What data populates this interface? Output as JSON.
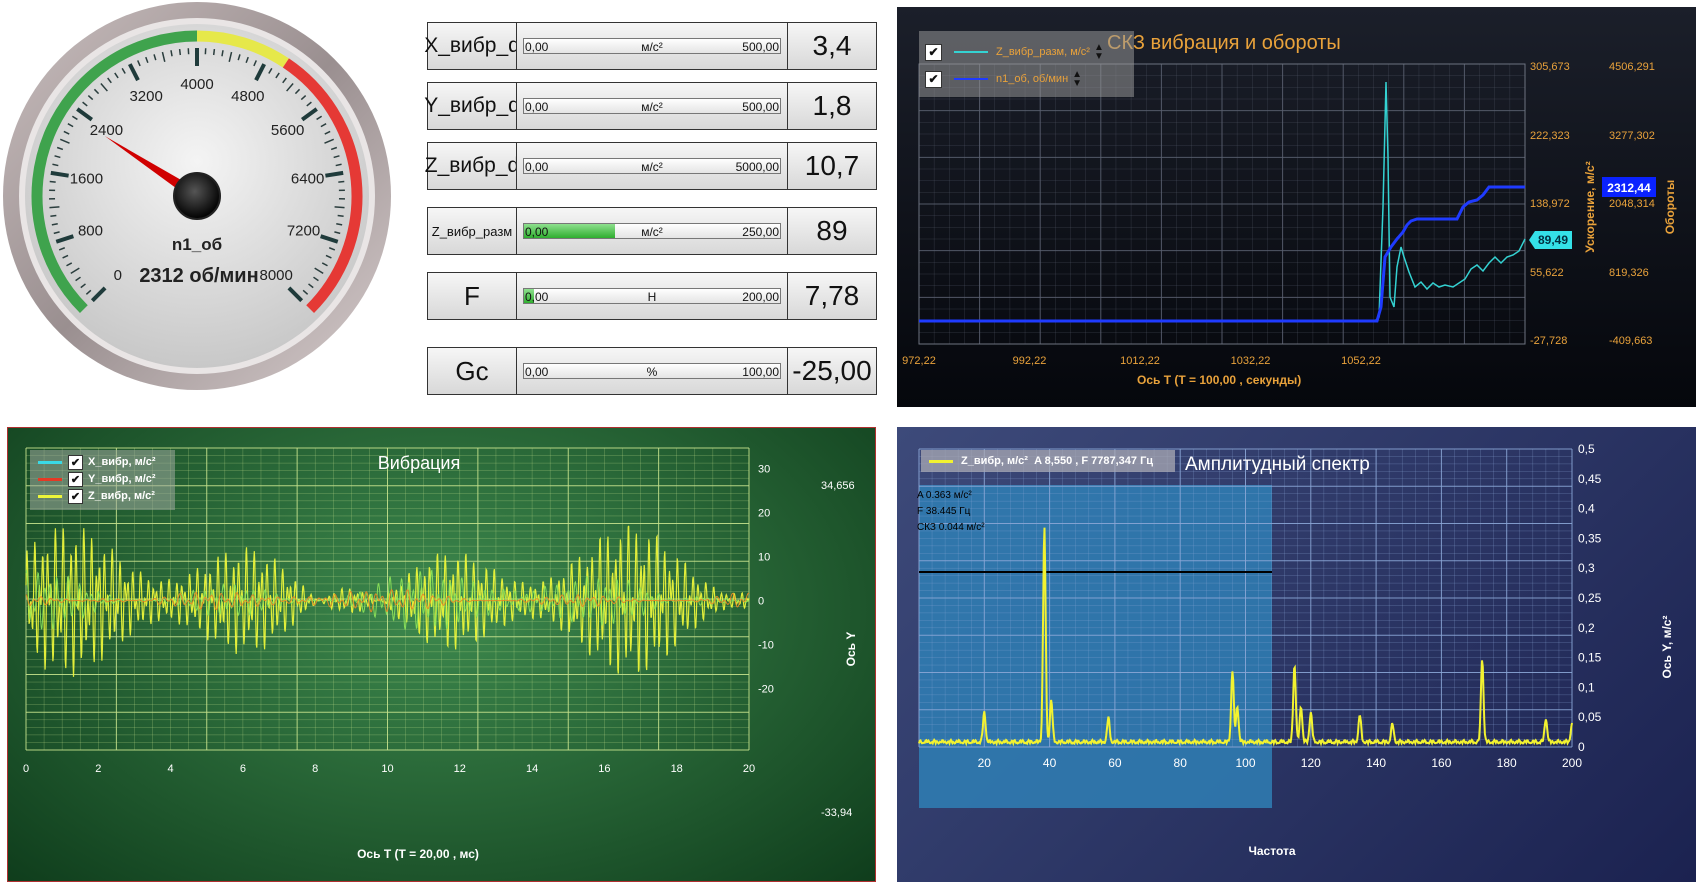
{
  "gauge": {
    "ticks": [
      "0",
      "800",
      "1600",
      "2400",
      "3200",
      "4000",
      "4800",
      "5600",
      "6400",
      "7200",
      "8000"
    ],
    "value": 2312,
    "max": 8000,
    "name": "n1_об",
    "readout": "2312 об/мин",
    "colors": {
      "green": "#3fa34d",
      "yellow": "#e6e84a",
      "red": "#e53935",
      "needle": "#d00000"
    }
  },
  "rows": [
    {
      "label": "X_вибр_d",
      "min": "0,00",
      "unit": "м/с²",
      "max": "500,00",
      "value": "3,4",
      "fill_fraction": 0
    },
    {
      "label": "Y_вибр_d",
      "min": "0,00",
      "unit": "м/с²",
      "max": "500,00",
      "value": "1,8",
      "fill_fraction": 0
    },
    {
      "label": "Z_вибр_d",
      "min": "0,00",
      "unit": "м/с²",
      "max": "5000,00",
      "value": "10,7",
      "fill_fraction": 0
    },
    {
      "label": "Z_вибр_разм",
      "min": "0,00",
      "unit": "м/с²",
      "max": "250,00",
      "value": "89",
      "fill_fraction": 0.356
    },
    {
      "label": "F",
      "min": "0,00",
      "unit": "Н",
      "max": "200,00",
      "value": "7,78",
      "fill_fraction": 0.039
    },
    {
      "label": "Gc",
      "min": "0,00",
      "unit": "%",
      "max": "100,00",
      "value": "-25,00",
      "fill_fraction": 0
    }
  ],
  "chart_skz": {
    "title": "СКЗ вибрация и обороты",
    "legend": [
      {
        "label": "Z_вибр_разм, м/с²",
        "color": "#34d2d2",
        "checked": true
      },
      {
        "label": "n1_об, об/мин",
        "color": "#1f3bff",
        "checked": true
      }
    ],
    "x_ticks": [
      "972,22",
      "992,22",
      "1012,22",
      "1032,22",
      "1052,22"
    ],
    "y1_ticks": [
      "305,673",
      "222,323",
      "138,972",
      "55,622",
      "-27,728"
    ],
    "y2_ticks": [
      "4506,291",
      "3277,302",
      "2048,314",
      "819,326",
      "-409,663"
    ],
    "y1_label": "Ускорение, м/с²",
    "y2_label": "Обороты",
    "x_label": "Ось Т   (Т = 100,00 , секунды)",
    "marker_n1": "2312,44",
    "marker_z": "89,49"
  },
  "chart_vibr": {
    "title": "Вибрация",
    "legend": [
      {
        "label": "X_вибр, м/с²",
        "color": "#3ad9e6",
        "checked": true
      },
      {
        "label": "Y_вибр, м/с²",
        "color": "#e53925",
        "checked": true
      },
      {
        "label": "Z_вибр, м/с²",
        "color": "#ecf53a",
        "checked": true
      }
    ],
    "x_ticks": [
      "0",
      "2",
      "4",
      "6",
      "8",
      "10",
      "12",
      "14",
      "16",
      "18",
      "20"
    ],
    "y_ticks": [
      "30",
      "20",
      "10",
      "0",
      "-10",
      "-20"
    ],
    "y_top": "34,656",
    "y_bottom": "-33,94",
    "y_label": "Ось Y",
    "x_label": "Ось Т  (Т = 20,00 , мс)"
  },
  "chart_spectrum": {
    "title": "Амплитудный спектр",
    "legend_text": "Z_вибр, м/с²  A 8,550 , F 7787,347 Гц",
    "legend_color": "#f2f230",
    "info": [
      "A 0.363 м/с²",
      "F 38.445 Гц",
      "СКЗ 0.044 м/с²"
    ],
    "x_ticks": [
      "20",
      "40",
      "60",
      "80",
      "100",
      "120",
      "140",
      "160",
      "180",
      "200"
    ],
    "y_ticks": [
      "0,5",
      "0,45",
      "0,4",
      "0,35",
      "0,3",
      "0,25",
      "0,2",
      "0,15",
      "0,1",
      "0,05",
      "0"
    ],
    "y_label": "Ось Y, м/с²",
    "x_label": "Частота"
  }
}
